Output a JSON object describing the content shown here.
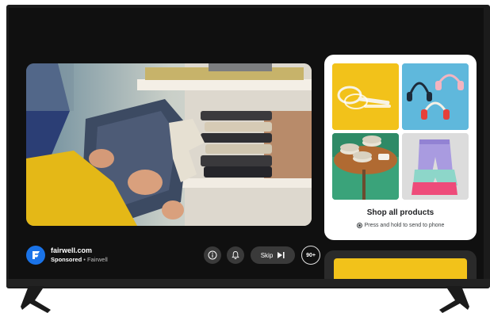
{
  "ad": {
    "domain": "fairwell.com",
    "sponsored_label": "Sponsored",
    "separator": " • ",
    "advertiser": "Fairwell",
    "brand_color": "#1a73e8"
  },
  "controls": {
    "info_icon": "info-icon",
    "bell_icon": "bell-icon",
    "skip_label": "Skip",
    "skip_icon": "skip-next-icon",
    "count_badge": "90+"
  },
  "shop": {
    "title": "Shop all products",
    "hint": "Press and hold to send to phone",
    "tiles": [
      {
        "name": "tennis-rackets",
        "bg": "#f2c21a"
      },
      {
        "name": "headphones",
        "bg": "#5fb8dc"
      },
      {
        "name": "plates-on-table",
        "bg": "#3aa37a"
      },
      {
        "name": "shorts",
        "bg": "#dcdcdc"
      }
    ]
  },
  "colors": {
    "screen_bg": "#101010",
    "button_bg": "#3a3a3a",
    "card_bg": "#ffffff"
  }
}
